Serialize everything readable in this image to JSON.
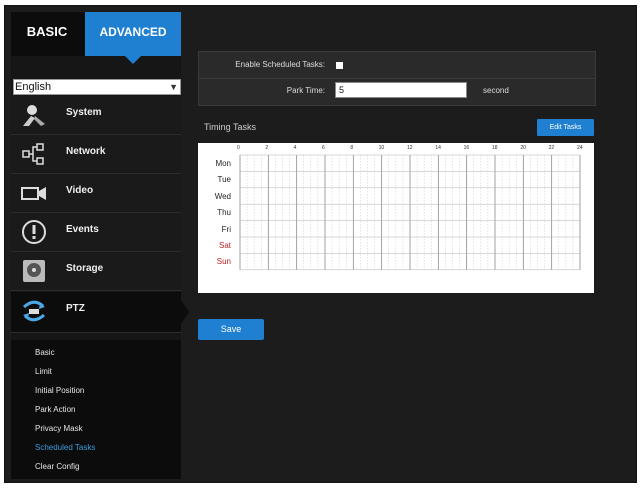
{
  "tabs": {
    "basic": "BASIC",
    "advanced": "ADVANCED"
  },
  "language": {
    "selected": "English"
  },
  "menu": [
    {
      "label": "System",
      "icon": "system-icon"
    },
    {
      "label": "Network",
      "icon": "network-icon"
    },
    {
      "label": "Video",
      "icon": "video-icon"
    },
    {
      "label": "Events",
      "icon": "events-icon"
    },
    {
      "label": "Storage",
      "icon": "storage-icon"
    },
    {
      "label": "PTZ",
      "icon": "ptz-icon"
    }
  ],
  "submenu": [
    "Basic",
    "Limit",
    "Initial Position",
    "Park Action",
    "Privacy Mask",
    "Scheduled Tasks",
    "Clear Config"
  ],
  "submenu_active": "Scheduled Tasks",
  "config": {
    "enable_label": "Enable Scheduled Tasks:",
    "enable_checked": false,
    "park_label": "Park Time:",
    "park_value": "5",
    "park_unit": "second"
  },
  "timing": {
    "title": "Timing Tasks",
    "edit_button": "Edit Tasks",
    "hours": [
      "0",
      "2",
      "4",
      "6",
      "8",
      "10",
      "12",
      "14",
      "16",
      "18",
      "20",
      "22",
      "24"
    ],
    "days": [
      "Mon",
      "Tue",
      "Wed",
      "Thu",
      "Fri",
      "Sat",
      "Sun"
    ]
  },
  "save_button": "Save",
  "colors": {
    "accent": "#1f7fd0",
    "weekend": "#c02020",
    "active_submenu": "#3b9ddd"
  }
}
